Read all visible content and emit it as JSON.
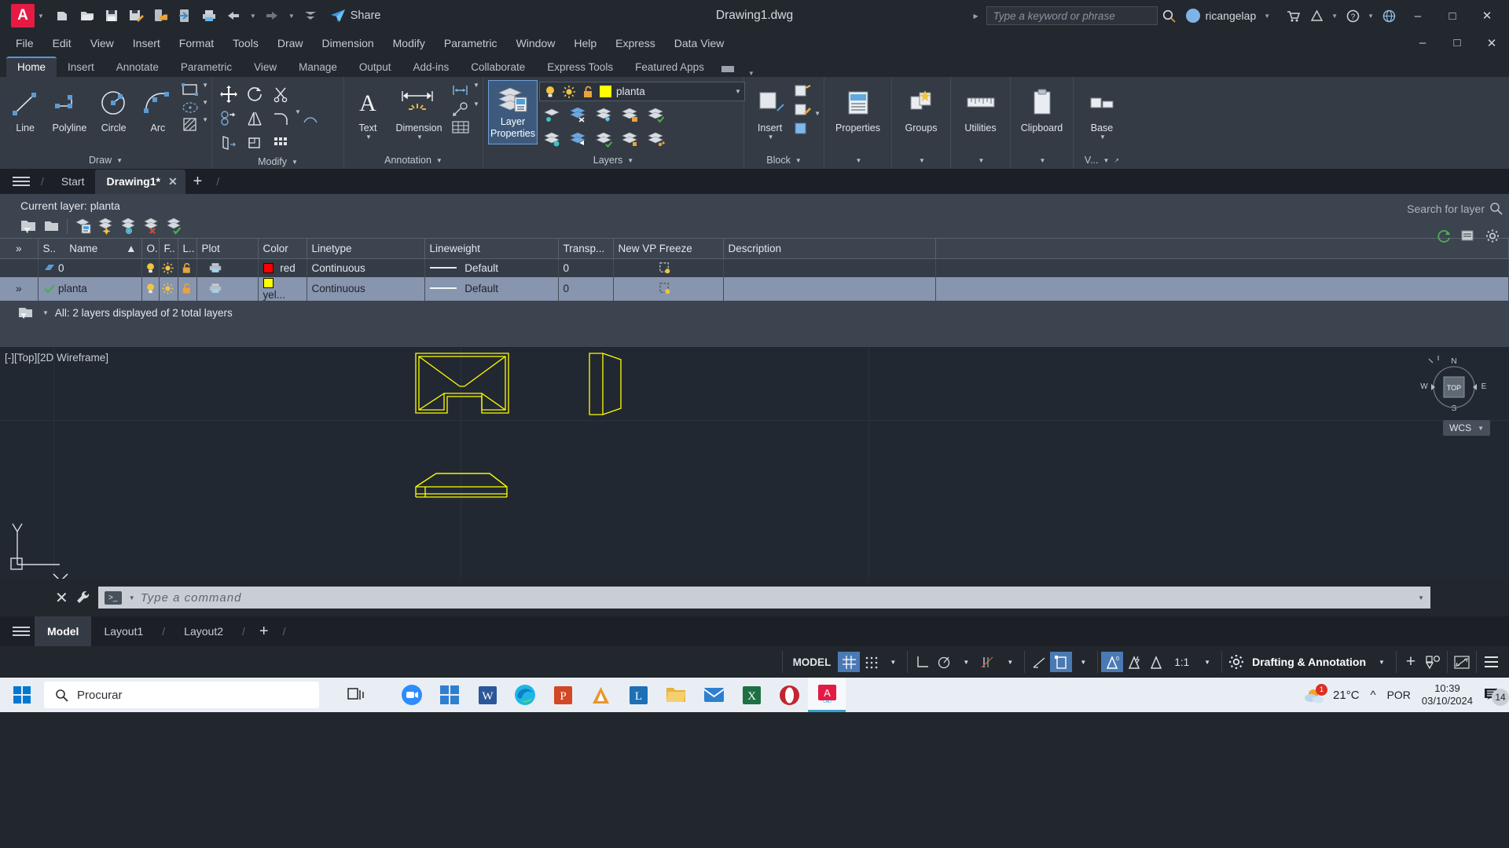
{
  "titlebar": {
    "logo": "A",
    "quick_access": [
      "new-icon",
      "open-icon",
      "save-icon",
      "save-as-icon",
      "save-cloud-icon",
      "plot-to-device-icon",
      "print-icon",
      "undo-icon",
      "redo-icon",
      "customize-icon"
    ],
    "share_label": "Share",
    "document_title": "Drawing1.dwg",
    "search_placeholder": "Type a keyword or phrase",
    "user_name": "ricangelap",
    "window_buttons": [
      "minimize",
      "restore",
      "close"
    ]
  },
  "menubar": {
    "items": [
      "File",
      "Edit",
      "View",
      "Insert",
      "Format",
      "Tools",
      "Draw",
      "Dimension",
      "Modify",
      "Parametric",
      "Window",
      "Help",
      "Express",
      "Data View"
    ],
    "right_buttons": [
      "minimize",
      "restore",
      "close"
    ]
  },
  "ribbon": {
    "tabs": [
      {
        "label": "Home",
        "active": true
      },
      {
        "label": "Insert",
        "active": false
      },
      {
        "label": "Annotate",
        "active": false
      },
      {
        "label": "Parametric",
        "active": false
      },
      {
        "label": "View",
        "active": false
      },
      {
        "label": "Manage",
        "active": false
      },
      {
        "label": "Output",
        "active": false
      },
      {
        "label": "Add-ins",
        "active": false
      },
      {
        "label": "Collaborate",
        "active": false
      },
      {
        "label": "Express Tools",
        "active": false
      },
      {
        "label": "Featured Apps",
        "active": false
      }
    ],
    "panels": [
      {
        "name": "Draw",
        "label": "Draw",
        "buttons": [
          "Line",
          "Polyline",
          "Circle",
          "Arc"
        ]
      },
      {
        "name": "Modify",
        "label": "Modify"
      },
      {
        "name": "Annotation",
        "label": "Annotation",
        "buttons": [
          "Text",
          "Dimension"
        ]
      },
      {
        "name": "Layers",
        "label": "Layers",
        "layer_properties_label": "Layer Properties"
      },
      {
        "name": "Block",
        "label": "Block",
        "buttons": [
          "Insert"
        ]
      },
      {
        "name": "Properties",
        "label": "Properties"
      },
      {
        "name": "Groups",
        "label": "Groups"
      },
      {
        "name": "Utilities",
        "label": "Utilities"
      },
      {
        "name": "Clipboard",
        "label": "Clipboard"
      },
      {
        "name": "View",
        "label": "V..."
      }
    ],
    "layer_combo": {
      "current_layer": "planta",
      "color_hex": "#ffff00",
      "icons": [
        "lightbulb-on-icon",
        "sun-icon",
        "unlock-icon"
      ]
    }
  },
  "file_tabs": {
    "items": [
      {
        "label": "Start",
        "active": false,
        "closable": false
      },
      {
        "label": "Drawing1*",
        "active": true,
        "closable": true
      }
    ],
    "add_label": "+"
  },
  "layer_manager": {
    "current_layer_text": "Current layer: planta",
    "search_placeholder": "Search for layer",
    "toolbar_icons": [
      "new-layer-filter-icon",
      "new-group-filter-icon",
      "layer-states-icon",
      "new-layer-icon",
      "new-layer-vp-frozen-icon",
      "delete-layer-icon",
      "set-current-icon"
    ],
    "right_icons": [
      "refresh-icon",
      "layer-list-icon",
      "settings-icon"
    ],
    "columns": [
      "S..",
      "Name",
      "O.",
      "F..",
      "L..",
      "Plot",
      "Color",
      "Linetype",
      "Lineweight",
      "Transp...",
      "New VP Freeze",
      "Description"
    ],
    "sort_column": "Name",
    "sort_direction": "asc",
    "rows": [
      {
        "status": "layer-icon",
        "name": "0",
        "on": "lightbulb-on-icon",
        "freeze": "sun-icon",
        "lock": "unlock-icon",
        "plot": "plot-icon",
        "color_name": "red",
        "color_hex": "#ff0000",
        "linetype": "Continuous",
        "lineweight": "Default",
        "transparency": "0",
        "new_vp_freeze": "vp-freeze-icon",
        "description": "",
        "selected": false
      },
      {
        "status": "check-icon",
        "name": "planta",
        "on": "lightbulb-on-icon",
        "freeze": "sun-icon",
        "lock": "unlock-icon",
        "plot": "plot-icon",
        "color_name": "yel...",
        "color_hex": "#ffff00",
        "linetype": "Continuous",
        "lineweight": "Default",
        "transparency": "0",
        "new_vp_freeze": "vp-freeze-icon",
        "description": "",
        "selected": true
      }
    ],
    "footer_text": "All: 2 layers displayed of 2 total layers"
  },
  "canvas": {
    "viewport_label": "[-][Top][2D Wireframe]",
    "drawing_color": "#ffff00",
    "background": "#222831",
    "viewcube": {
      "top": "TOP",
      "north": "N",
      "south": "S",
      "west": "W",
      "east": "E",
      "wcs_label": "WCS"
    }
  },
  "command_line": {
    "placeholder": "Type a command",
    "close_label": "×",
    "tool_icon": "wrench-icon"
  },
  "layout_tabs": {
    "items": [
      {
        "label": "Model",
        "active": true
      },
      {
        "label": "Layout1",
        "active": false
      },
      {
        "label": "Layout2",
        "active": false
      }
    ],
    "add_label": "+"
  },
  "status_bar": {
    "model_label": "MODEL",
    "toggles": [
      {
        "name": "grid-display",
        "icon": "grid-icon",
        "on": true
      },
      {
        "name": "snap-mode",
        "icon": "snap-icon",
        "on": false
      },
      {
        "name": "ortho-mode",
        "icon": "ortho-icon",
        "on": false
      },
      {
        "name": "polar-tracking",
        "icon": "polar-icon",
        "on": false
      },
      {
        "name": "object-snap",
        "icon": "osnap-icon",
        "on": false
      },
      {
        "name": "object-snap-tracking",
        "icon": "otrack-icon",
        "on": false
      },
      {
        "name": "lineweight",
        "icon": "lineweight-icon",
        "on": false
      },
      {
        "name": "transparency",
        "icon": "transparency-icon",
        "on": true
      },
      {
        "name": "annotation-visibility",
        "icon": "annot-visibility-icon",
        "on": true
      },
      {
        "name": "autoscale",
        "icon": "autoscale-icon",
        "on": false
      },
      {
        "name": "annotation-scale",
        "icon": "annot-scale-icon",
        "on": false
      }
    ],
    "annotation_scale": "1:1",
    "workspace": "Drafting & Annotation",
    "right_icons": [
      "add-tool-icon",
      "isolate-objects-icon",
      "fullscreen-icon",
      "customization-icon"
    ]
  },
  "taskbar": {
    "start_icon": "windows-start-icon",
    "search_placeholder": "Procurar",
    "taskview_icon": "task-view-icon",
    "apps": [
      {
        "name": "zoom",
        "label": "zoom"
      },
      {
        "name": "microsoft-store",
        "label": ""
      },
      {
        "name": "word",
        "label": "W"
      },
      {
        "name": "edge",
        "label": ""
      },
      {
        "name": "powerpoint",
        "label": "P"
      },
      {
        "name": "autodesk-app",
        "label": ""
      },
      {
        "name": "lumion",
        "label": "L"
      },
      {
        "name": "file-explorer",
        "label": ""
      },
      {
        "name": "mail",
        "label": ""
      },
      {
        "name": "excel",
        "label": "X"
      },
      {
        "name": "opera",
        "label": ""
      },
      {
        "name": "autocad",
        "label": "A",
        "active": true
      }
    ],
    "weather": {
      "temp": "21°C",
      "badge": "1"
    },
    "language": "POR",
    "clock_time": "10:39",
    "clock_date": "03/10/2024",
    "notification_count": "14"
  }
}
